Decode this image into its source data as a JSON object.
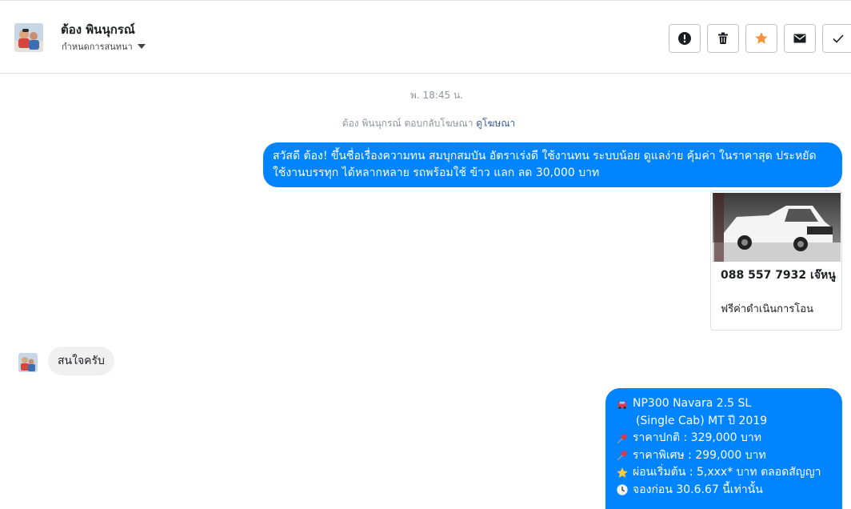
{
  "header": {
    "contact_name": "ต้อง พินนุกรณ์",
    "subtitle": "กำหนดการสนทนา",
    "actions": [
      {
        "name": "report",
        "icon": "alert-icon"
      },
      {
        "name": "delete",
        "icon": "trash-icon"
      },
      {
        "name": "star",
        "icon": "star-icon"
      },
      {
        "name": "mark-unread",
        "icon": "envelope-icon"
      },
      {
        "name": "done",
        "icon": "check-icon"
      }
    ]
  },
  "conversation": {
    "timestamp": "พ. 18:45 น.",
    "reply_note": "ต้อง พินนุกรณ์ ตอบกลับโฆษณา",
    "reply_link": "ดูโฆษณา",
    "message1": "สวัสดี ต้อง! ขึ้นชื่อเรื่องความทน สมบุกสมบัน อัตราเร่งดี ใช้งานทน ระบบน้อย ดูแลง่าย คุ้มค่า ในราคาสุด ประหยัด ใช้งานบรรทุก ได้หลากหลาย รถพร้อมใช้ ข้าว แลก ลด 30,000 บาท",
    "card": {
      "title": "088 557 7932 เจ๊หนู",
      "description": "ฟรีค่าดำเนินการโอน"
    },
    "incoming": "สนใจครับ",
    "message2": {
      "lines": [
        {
          "icon": "car-icon",
          "text": "NP300 Navara 2.5 SL"
        },
        {
          "icon": "",
          "text": "(Single Cab) MT ปี 2019"
        },
        {
          "icon": "pushpin-icon",
          "text": "ราคาปกติ : 329,000 บาท"
        },
        {
          "icon": "pushpin-icon",
          "text": "ราคาพิเศษ : 299,000 บาท"
        },
        {
          "icon": "star-icon",
          "text": "ผ่อนเริ่มต้น : 5,xxx* บาท  ตลอดสัญญา"
        },
        {
          "icon": "clock-icon",
          "text": "จองก่อน 30.6.67 นี้เท่านั้น"
        }
      ]
    }
  },
  "colors": {
    "outgoing_bubble": "#0084ff",
    "incoming_bubble": "#f1f0f0",
    "star_accent": "#f7923a",
    "link": "#385898"
  }
}
